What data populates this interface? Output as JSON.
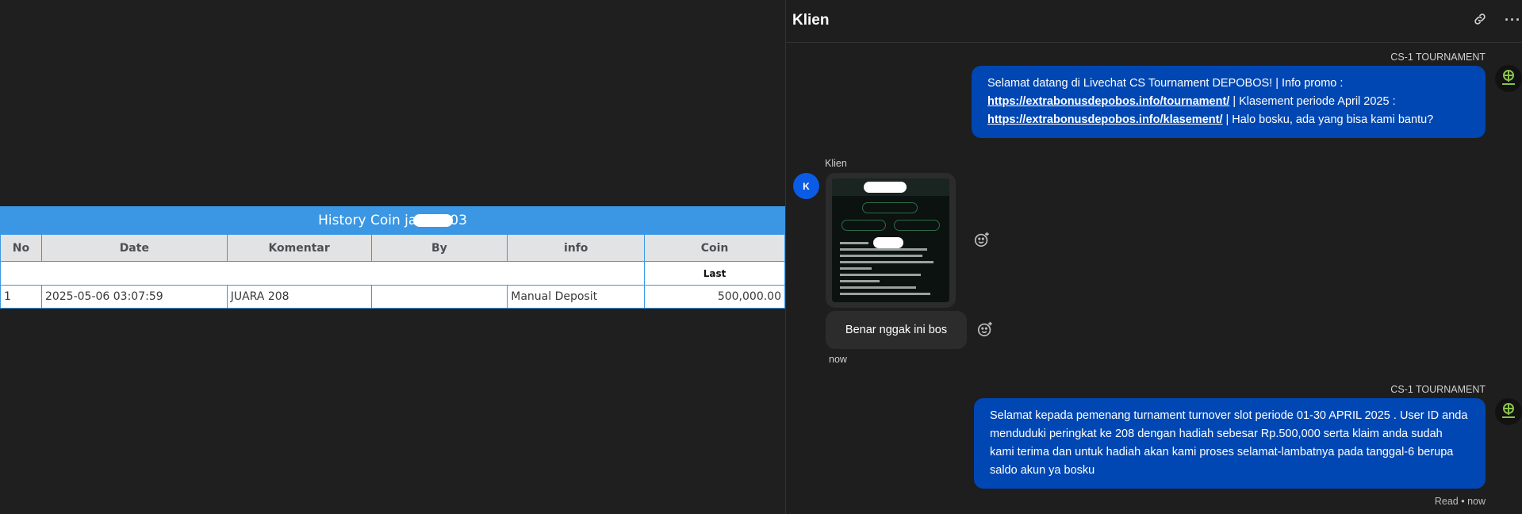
{
  "history": {
    "title_start": "History Coin ja",
    "title_end": "03",
    "columns": [
      "No",
      "Date",
      "Komentar",
      "By",
      "info",
      "Coin"
    ],
    "subheader_last": "Last",
    "rows": [
      {
        "no": "1",
        "date": "2025-05-06 03:07:59",
        "komentar": "JUARA 208",
        "by": "",
        "info": "Manual Deposit",
        "coin": "500,000.00"
      }
    ]
  },
  "chat": {
    "title": "Klien",
    "header_icons": [
      "link-icon",
      "more-icon"
    ],
    "more_glyph": "···",
    "msg1": {
      "sender": "CS-1 TOURNAMENT",
      "text_a": "Selamat datang di Livechat CS Tournament DEPOBOS! | Info promo :",
      "link1": "https://extrabonusdepobos.info/tournament/",
      "text_b": " | Klasement periode April 2025 :",
      "link2": "https://extrabonusdepobos.info/klasement/",
      "text_c": " | Halo bosku, ada yang bisa kami bantu?"
    },
    "client": {
      "name": "Klien",
      "avatar_letter": "K",
      "image_caption": "Selamat kepada ... pemenang tomba TURNAMEN ... DEPOBOS pada periode 01 APRIL - 30 APRIL pada peringkat 208 dan hadiah sebesar Rp.500,000 anda bisa langsung klaim pada CS tournament di link berikut ya bosku https://extrabonusdepobos.info/tournament/",
      "text": "Benar nggak ini bos",
      "time": "now"
    },
    "msg2": {
      "sender": "CS-1 TOURNAMENT",
      "text": "Selamat kepada pemenang turnament turnover slot periode 01-30 APRIL 2025 . User ID anda menduduki peringkat ke 208 dengan hadiah sebesar Rp.500,000 serta klaim anda sudah kami terima dan untuk hadiah akan kami proses selamat-lambatnya pada tanggal-6 berupa saldo akun ya bosku",
      "status": "Read • now"
    },
    "colors": {
      "agent_bubble": "#0047b3",
      "client_avatar": "#0a5ce6",
      "table_header": "#3b97e3",
      "coin": "#1f8b2f"
    }
  }
}
